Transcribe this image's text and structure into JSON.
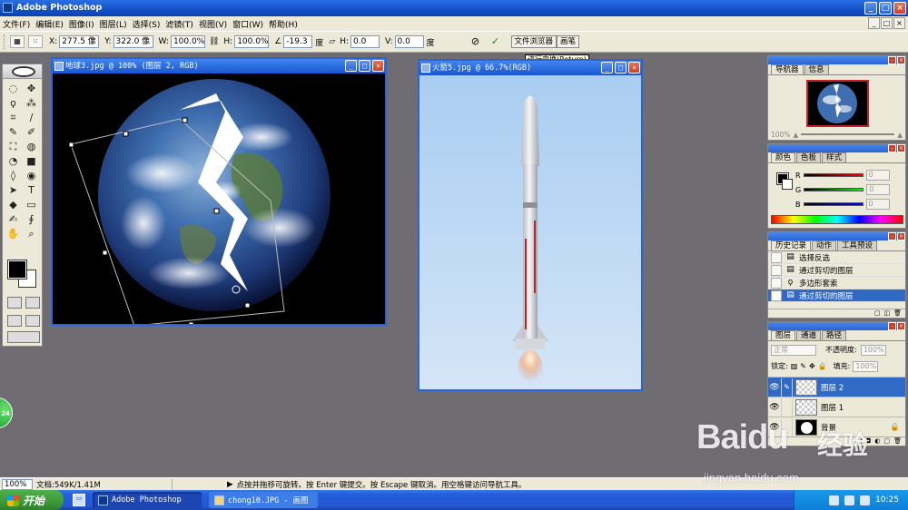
{
  "app": {
    "title": "Adobe Photoshop",
    "window_buttons": [
      "_",
      "□",
      "×"
    ]
  },
  "menu": {
    "items": [
      "文件(F)",
      "编辑(E)",
      "图像(I)",
      "图层(L)",
      "选择(S)",
      "滤镜(T)",
      "视图(V)",
      "窗口(W)",
      "帮助(H)"
    ],
    "mdi_buttons": [
      "_",
      "□",
      "×"
    ]
  },
  "options": {
    "x_label": "X:",
    "x_value": "277.5 像",
    "y_label": "Y:",
    "y_value": "322.0 像",
    "w_label": "W:",
    "w_value": "100.0%",
    "h_label": "H:",
    "h_value": "100.0%",
    "angle_value": "-19.3",
    "angle_unit": "度",
    "hskew_label": "H:",
    "hskew_value": "0.0",
    "vskew_label": "V:",
    "vskew_value": "0.0",
    "skew_unit": "度",
    "cancel_glyph": "⊘",
    "commit_glyph": "✓",
    "tab_file_browser": "文件浏览器",
    "tab_brushes": "画笔",
    "tooltip": "进行变换(Return)"
  },
  "toolbox": {
    "tools": [
      "◌",
      "✥",
      "ϙ",
      "⁂",
      "⌗",
      "∕",
      "✎",
      "✐",
      "⛶",
      "◍",
      "◔",
      "■",
      "◊",
      "◉",
      "➤",
      "T",
      "◆",
      "▭",
      "✍",
      "∮",
      "✋",
      "⌕"
    ]
  },
  "documents": {
    "earth": {
      "title": "地球3.jpg @ 100% (图层 2, RGB)"
    },
    "rocket": {
      "title": "火箭5.jpg @ 66.7%(RGB)"
    }
  },
  "navigator": {
    "tabs": [
      "导航器",
      "信息"
    ],
    "zoom": "100%"
  },
  "color_panel": {
    "tabs": [
      "颜色",
      "色板",
      "样式"
    ],
    "r_label": "R",
    "g_label": "G",
    "b_label": "B",
    "r_value": "0",
    "g_value": "0",
    "b_value": "0"
  },
  "history": {
    "tabs": [
      "历史记录",
      "动作",
      "工具预设"
    ],
    "items": [
      {
        "label": "选择反选",
        "icon": "▤"
      },
      {
        "label": "通过剪切的图层",
        "icon": "▤"
      },
      {
        "label": "多边形套索",
        "icon": "ϙ"
      },
      {
        "label": "通过剪切的图层",
        "icon": "▤"
      }
    ],
    "selected_index": 3
  },
  "layers": {
    "tabs": [
      "图层",
      "通道",
      "路径"
    ],
    "blend_mode": "正常",
    "opacity_label": "不透明度:",
    "opacity_value": "100%",
    "lock_label": "锁定:",
    "fill_label": "填充:",
    "fill_value": "100%",
    "items": [
      {
        "name": "图层 2",
        "selected": true
      },
      {
        "name": "图层 1",
        "selected": false
      },
      {
        "name": "背景",
        "selected": false,
        "locked": true
      }
    ]
  },
  "status": {
    "zoom": "100%",
    "doc": "文档:549K/1.41M",
    "arrow": "▶",
    "hint": "点按并拖移可旋转。按 Enter 键提交。按 Escape 键取消。用空格键访问导航工具。"
  },
  "taskbar": {
    "start": "开始",
    "tasks": [
      {
        "label": "Adobe Photoshop",
        "active": true
      },
      {
        "label": "chong10.JPG - 画图",
        "active": false
      }
    ],
    "clock": "10:25"
  },
  "overlay": {
    "badge": "24",
    "watermark_brand": "Baidu",
    "watermark_cn": "经验",
    "watermark_url": "jingyan.baidu.com"
  }
}
